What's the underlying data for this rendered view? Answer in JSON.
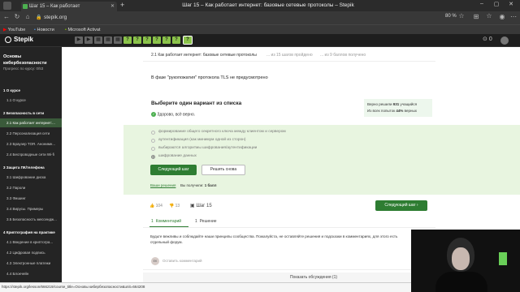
{
  "browser": {
    "tab_title": "Шаг 15 – Как работает",
    "new_tab": "+",
    "window_title": "Шаг 15 – Как работает интернет: базовые сетевые протоколы – Stepik",
    "url": "stepik.org",
    "zoom": "80 %",
    "status_url": "https://stepik.org/lesson/666219/course_title=Основы кибербезопасности&unit=664208"
  },
  "bookmarks": [
    "YouTube",
    "Новости",
    "Microsoft Activat"
  ],
  "stepbar": {
    "items": [
      "?",
      "?",
      "?",
      "?",
      "?",
      "?",
      "?",
      "?",
      "?",
      "?"
    ],
    "counter": "0"
  },
  "sidebar": {
    "logo": "Stepik",
    "course_title_1": "Основы",
    "course_title_2": "кибербезопасности",
    "progress": "Прогресс по курсу: 0/53",
    "items": [
      {
        "label": "1  О курсе",
        "type": "sec"
      },
      {
        "label": "1.1  О курсе",
        "type": "sub"
      },
      {
        "label": "2  Безопасность в сети",
        "type": "sec"
      },
      {
        "label": "2.1  Как работает интернет:...",
        "type": "act"
      },
      {
        "label": "2.2  Персонализация сети",
        "type": "sub"
      },
      {
        "label": "2.3  Браузер TOR. Анонимн...",
        "type": "sub"
      },
      {
        "label": "2.4  Беспроводные сети Wi-fi",
        "type": "sub"
      },
      {
        "label": "3  Защита ПК/телефона",
        "type": "sec"
      },
      {
        "label": "3.1  Шифрование диска",
        "type": "sub"
      },
      {
        "label": "3.2  Пароли",
        "type": "sub"
      },
      {
        "label": "3.3  Фишинг",
        "type": "sub"
      },
      {
        "label": "3.4  Вирусы. Примеры",
        "type": "sub"
      },
      {
        "label": "3.5  Безопасность мессендж...",
        "type": "sub"
      },
      {
        "label": "4  Криптография на практике",
        "type": "sec"
      },
      {
        "label": "4.1  Введение в криптогра...",
        "type": "sub"
      },
      {
        "label": "4.2  Цифровая подпись",
        "type": "sub"
      },
      {
        "label": "4.3  Электронные платежи",
        "type": "sub"
      },
      {
        "label": "4.4  Блокчейн",
        "type": "sub"
      }
    ]
  },
  "lesson": {
    "header": "2.1 Как работает интернет: базовые сетевые протоколы",
    "header_steps": "... из 15 шагов пройдено",
    "header_points": "... из 9 баллов получено",
    "question": "В фазе \"рукопожатия\" протокола TLS не предусмотрено",
    "task_title": "Выберите один вариант из списка",
    "correct_msg": "Здорово, всё верно.",
    "stats_line1_pre": "Верно решили ",
    "stats_count": "931",
    "stats_line1_post": " учащийся",
    "stats_line2_pre": "Из всех попыток ",
    "stats_pct": "44%",
    "stats_line2_post": " верных",
    "options": [
      "формирование общего секретного ключа между клиентом и сервером",
      "аутентификация (как минимум одной из сторон)",
      "выбираются алгоритмы шифрования/аутентификации",
      "шифрование данных"
    ],
    "next_step": "Следующий шаг",
    "solve_again": "Решить снова",
    "your_solutions": "Ваши решения",
    "earned": "Вы получили: ",
    "earned_val": "1 балл",
    "likes": "104",
    "dislikes": "13",
    "step_label": "Шаг 15",
    "next_step_2": "Следующий шаг",
    "tab_comments_count": "1",
    "tab_comments": "Комментарий",
    "tab_solutions_count": "1",
    "tab_solutions": "Решение",
    "comments_rules": "Будьте вежливы и соблюдайте наши принципы сообщества. Пожалуйста, не оставляйте решения и подсказки в комментариях, для этого есть отдельный форум.",
    "avatar_initials": "EK",
    "leave_comment": "Оставить комментарий",
    "show_discussions": "Показать обсуждения (1)"
  }
}
